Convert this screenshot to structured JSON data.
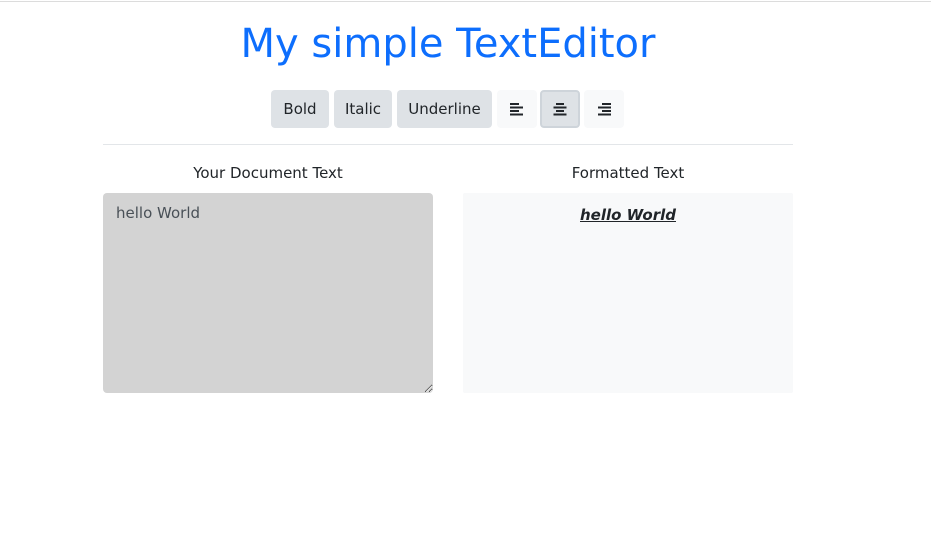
{
  "header": {
    "title": "My simple TextEditor",
    "accent_color": "#0d6efd"
  },
  "toolbar": {
    "bold_label": "Bold",
    "italic_label": "Italic",
    "underline_label": "Underline",
    "align_left_icon": "align-left-icon",
    "align_center_icon": "align-center-icon",
    "align_right_icon": "align-right-icon",
    "active_alignment": "center"
  },
  "editor": {
    "input_label": "Your Document Text",
    "input_value": "hello World",
    "input_background": "#d3d3d3"
  },
  "preview": {
    "label": "Formatted Text",
    "text": "hello World",
    "bold": true,
    "italic": true,
    "underline": true,
    "alignment": "center"
  }
}
